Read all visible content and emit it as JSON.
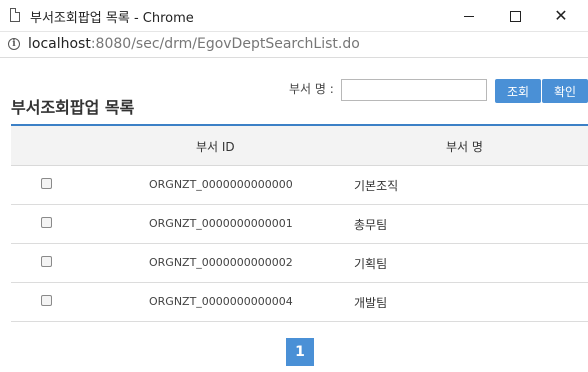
{
  "window": {
    "title": "부서조회팝업 목록 - Chrome"
  },
  "address": {
    "host": "localhost",
    "rest": ":8080/sec/drm/EgovDeptSearchList.do"
  },
  "search": {
    "label": "부서 명 :",
    "value": "",
    "search_button": "조회",
    "confirm_button": "확인"
  },
  "page_title": "부서조회팝업 목록",
  "table": {
    "headers": [
      "부서 ID",
      "부서 명"
    ],
    "rows": [
      {
        "id": "ORGNZT_0000000000000",
        "name": "기본조직"
      },
      {
        "id": "ORGNZT_0000000000001",
        "name": "총무팀"
      },
      {
        "id": "ORGNZT_0000000000002",
        "name": "기획팀"
      },
      {
        "id": "ORGNZT_0000000000004",
        "name": "개발팀"
      }
    ]
  },
  "pagination": {
    "current": "1"
  }
}
